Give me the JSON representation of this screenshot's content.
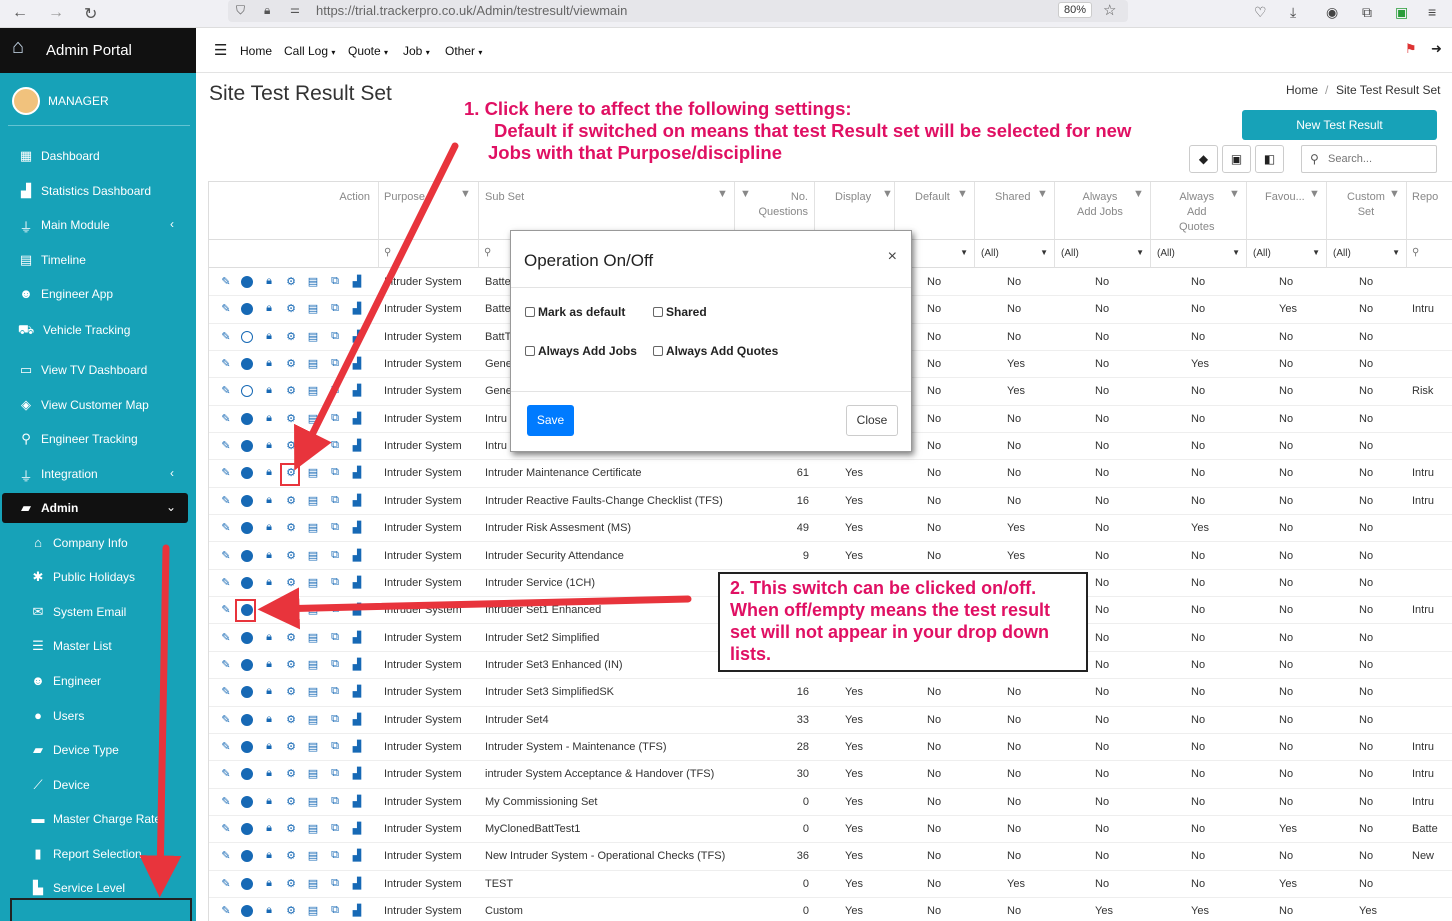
{
  "browser": {
    "url": "https://trial.trackerpro.co.uk/Admin/testresult/viewmain",
    "zoom": "80%"
  },
  "sidebar": {
    "brand": "Admin Portal",
    "user": "MANAGER",
    "items": [
      {
        "label": "Dashboard"
      },
      {
        "label": "Statistics Dashboard"
      },
      {
        "label": "Main Module"
      },
      {
        "label": "Timeline"
      },
      {
        "label": "Engineer App"
      },
      {
        "label": "Vehicle Tracking"
      },
      {
        "label": "View TV Dashboard"
      },
      {
        "label": "View Customer Map"
      },
      {
        "label": "Engineer Tracking"
      },
      {
        "label": "Integration"
      },
      {
        "label": "Admin"
      }
    ],
    "subitems": [
      {
        "label": "Company Info"
      },
      {
        "label": "Public Holidays"
      },
      {
        "label": "System Email"
      },
      {
        "label": "Master List"
      },
      {
        "label": "Engineer"
      },
      {
        "label": "Users"
      },
      {
        "label": "Device Type"
      },
      {
        "label": "Device"
      },
      {
        "label": "Master Charge Rate"
      },
      {
        "label": "Report Selection"
      },
      {
        "label": "Service Level"
      }
    ]
  },
  "topnav": {
    "home": "Home",
    "call_log": "Call Log",
    "quote": "Quote",
    "job": "Job",
    "other": "Other"
  },
  "page": {
    "title": "Site Test Result Set",
    "breadcrumb_home": "Home",
    "breadcrumb_sep": "/",
    "breadcrumb_current": "Site Test Result Set",
    "new_button": "New Test Result",
    "search_placeholder": "Search..."
  },
  "grid": {
    "headers": {
      "action": "Action",
      "purpose": "Purpose",
      "subset": "Sub Set",
      "noq_1": "No.",
      "noq_2": "Questions",
      "display": "Display",
      "default": "Default",
      "shared": "Shared",
      "aaj_1": "Always",
      "aaj_2": "Add Jobs",
      "aaq_1": "Always",
      "aaq_2": "Add",
      "aaq_3": "Quotes",
      "favou": "Favou...",
      "custom_1": "Custom",
      "custom_2": "Set",
      "repo": "Repo"
    },
    "filter_all": "(All)",
    "rows": [
      {
        "toggle": true,
        "purpose": "Intruder System",
        "subset": "Batte",
        "noq": "",
        "display": "",
        "default": "No",
        "shared": "No",
        "aaj": "No",
        "aaq": "No",
        "fav": "No",
        "custom": "No",
        "repo": ""
      },
      {
        "toggle": true,
        "purpose": "Intruder System",
        "subset": "Batte",
        "noq": "",
        "display": "",
        "default": "No",
        "shared": "No",
        "aaj": "No",
        "aaq": "No",
        "fav": "Yes",
        "custom": "No",
        "repo": "Intru"
      },
      {
        "toggle": false,
        "purpose": "Intruder System",
        "subset": "BattT",
        "noq": "",
        "display": "",
        "default": "No",
        "shared": "No",
        "aaj": "No",
        "aaq": "No",
        "fav": "No",
        "custom": "No",
        "repo": ""
      },
      {
        "toggle": true,
        "purpose": "Intruder System",
        "subset": "Gene",
        "noq": "",
        "display": "",
        "default": "No",
        "shared": "Yes",
        "aaj": "No",
        "aaq": "Yes",
        "fav": "No",
        "custom": "No",
        "repo": ""
      },
      {
        "toggle": false,
        "purpose": "Intruder System",
        "subset": "Gene",
        "noq": "",
        "display": "",
        "default": "No",
        "shared": "Yes",
        "aaj": "No",
        "aaq": "No",
        "fav": "No",
        "custom": "No",
        "repo": "Risk"
      },
      {
        "toggle": true,
        "purpose": "Intruder System",
        "subset": "Intru",
        "noq": "",
        "display": "",
        "default": "No",
        "shared": "No",
        "aaj": "No",
        "aaq": "No",
        "fav": "No",
        "custom": "No",
        "repo": ""
      },
      {
        "toggle": true,
        "purpose": "Intruder System",
        "subset": "Intru",
        "noq": "",
        "display": "",
        "default": "No",
        "shared": "No",
        "aaj": "No",
        "aaq": "No",
        "fav": "No",
        "custom": "No",
        "repo": ""
      },
      {
        "toggle": true,
        "purpose": "Intruder System",
        "subset": "Intruder Maintenance Certificate",
        "noq": "61",
        "display": "Yes",
        "default": "No",
        "shared": "No",
        "aaj": "No",
        "aaq": "No",
        "fav": "No",
        "custom": "No",
        "repo": "Intru"
      },
      {
        "toggle": true,
        "purpose": "Intruder System",
        "subset": "Intruder Reactive Faults-Change Checklist (TFS)",
        "noq": "16",
        "display": "Yes",
        "default": "No",
        "shared": "No",
        "aaj": "No",
        "aaq": "No",
        "fav": "No",
        "custom": "No",
        "repo": "Intru"
      },
      {
        "toggle": true,
        "purpose": "Intruder System",
        "subset": "Intruder Risk Assesment (MS)",
        "noq": "49",
        "display": "Yes",
        "default": "No",
        "shared": "Yes",
        "aaj": "No",
        "aaq": "Yes",
        "fav": "No",
        "custom": "No",
        "repo": ""
      },
      {
        "toggle": true,
        "purpose": "Intruder System",
        "subset": "Intruder Security Attendance",
        "noq": "9",
        "display": "Yes",
        "default": "No",
        "shared": "Yes",
        "aaj": "No",
        "aaq": "No",
        "fav": "No",
        "custom": "No",
        "repo": ""
      },
      {
        "toggle": true,
        "purpose": "Intruder System",
        "subset": "Intruder Service (1CH)",
        "noq": "",
        "display": "",
        "default": "",
        "shared": "",
        "aaj": "No",
        "aaq": "No",
        "fav": "No",
        "custom": "No",
        "repo": ""
      },
      {
        "toggle": true,
        "purpose": "Intruder System",
        "subset": "Intruder Set1 Enhanced",
        "noq": "",
        "display": "",
        "default": "",
        "shared": "",
        "aaj": "No",
        "aaq": "No",
        "fav": "No",
        "custom": "No",
        "repo": "Intru"
      },
      {
        "toggle": true,
        "purpose": "Intruder System",
        "subset": "Intruder Set2 Simplified",
        "noq": "",
        "display": "",
        "default": "",
        "shared": "",
        "aaj": "No",
        "aaq": "No",
        "fav": "No",
        "custom": "No",
        "repo": ""
      },
      {
        "toggle": true,
        "purpose": "Intruder System",
        "subset": "Intruder Set3 Enhanced (IN)",
        "noq": "",
        "display": "",
        "default": "",
        "shared": "",
        "aaj": "No",
        "aaq": "No",
        "fav": "No",
        "custom": "No",
        "repo": ""
      },
      {
        "toggle": true,
        "purpose": "Intruder System",
        "subset": "Intruder Set3 SimplifiedSK",
        "noq": "16",
        "display": "Yes",
        "default": "No",
        "shared": "No",
        "aaj": "No",
        "aaq": "No",
        "fav": "No",
        "custom": "No",
        "repo": ""
      },
      {
        "toggle": true,
        "purpose": "Intruder System",
        "subset": "Intruder Set4",
        "noq": "33",
        "display": "Yes",
        "default": "No",
        "shared": "No",
        "aaj": "No",
        "aaq": "No",
        "fav": "No",
        "custom": "No",
        "repo": ""
      },
      {
        "toggle": true,
        "purpose": "Intruder System",
        "subset": "Intruder System - Maintenance (TFS)",
        "noq": "28",
        "display": "Yes",
        "default": "No",
        "shared": "No",
        "aaj": "No",
        "aaq": "No",
        "fav": "No",
        "custom": "No",
        "repo": "Intru"
      },
      {
        "toggle": true,
        "purpose": "Intruder System",
        "subset": "intruder System Acceptance & Handover (TFS)",
        "noq": "30",
        "display": "Yes",
        "default": "No",
        "shared": "No",
        "aaj": "No",
        "aaq": "No",
        "fav": "No",
        "custom": "No",
        "repo": "Intru"
      },
      {
        "toggle": true,
        "purpose": "Intruder System",
        "subset": "My Commissioning Set",
        "noq": "0",
        "display": "Yes",
        "default": "No",
        "shared": "No",
        "aaj": "No",
        "aaq": "No",
        "fav": "No",
        "custom": "No",
        "repo": "Intru"
      },
      {
        "toggle": true,
        "purpose": "Intruder System",
        "subset": "MyClonedBattTest1",
        "noq": "0",
        "display": "Yes",
        "default": "No",
        "shared": "No",
        "aaj": "No",
        "aaq": "No",
        "fav": "Yes",
        "custom": "No",
        "repo": "Batte"
      },
      {
        "toggle": true,
        "purpose": "Intruder System",
        "subset": "New Intruder System - Operational Checks (TFS)",
        "noq": "36",
        "display": "Yes",
        "default": "No",
        "shared": "No",
        "aaj": "No",
        "aaq": "No",
        "fav": "No",
        "custom": "No",
        "repo": "New"
      },
      {
        "toggle": true,
        "purpose": "Intruder System",
        "subset": "TEST",
        "noq": "0",
        "display": "Yes",
        "default": "No",
        "shared": "Yes",
        "aaj": "No",
        "aaq": "No",
        "fav": "Yes",
        "custom": "No",
        "repo": ""
      },
      {
        "toggle": true,
        "purpose": "Intruder System",
        "subset": "Custom",
        "noq": "0",
        "display": "Yes",
        "default": "No",
        "shared": "No",
        "aaj": "Yes",
        "aaq": "Yes",
        "fav": "No",
        "custom": "Yes",
        "repo": ""
      }
    ]
  },
  "modal": {
    "title": "Operation On/Off",
    "close_x": "×",
    "mark_default": "Mark as default",
    "shared": "Shared",
    "always_jobs": "Always Add Jobs",
    "always_quotes": "Always Add Quotes",
    "save": "Save",
    "close": "Close"
  },
  "annotations": {
    "a1_line1": "1. Click here to affect the following settings:",
    "a1_line2": "Default if switched on means that test Result set will be selected for new",
    "a1_line3": "Jobs with that Purpose/discipline",
    "a2_line1": "2. This switch can be clicked on/off.",
    "a2_line2": "When off/empty means the test result",
    "a2_line3": "set will not appear in your drop down",
    "a2_line4": "lists."
  },
  "colors": {
    "sidebar": "#17a2b8",
    "brand_bg": "#111111",
    "accent_blue": "#1769b5",
    "annotation": "#e01063",
    "arrow": "#e8343c"
  }
}
